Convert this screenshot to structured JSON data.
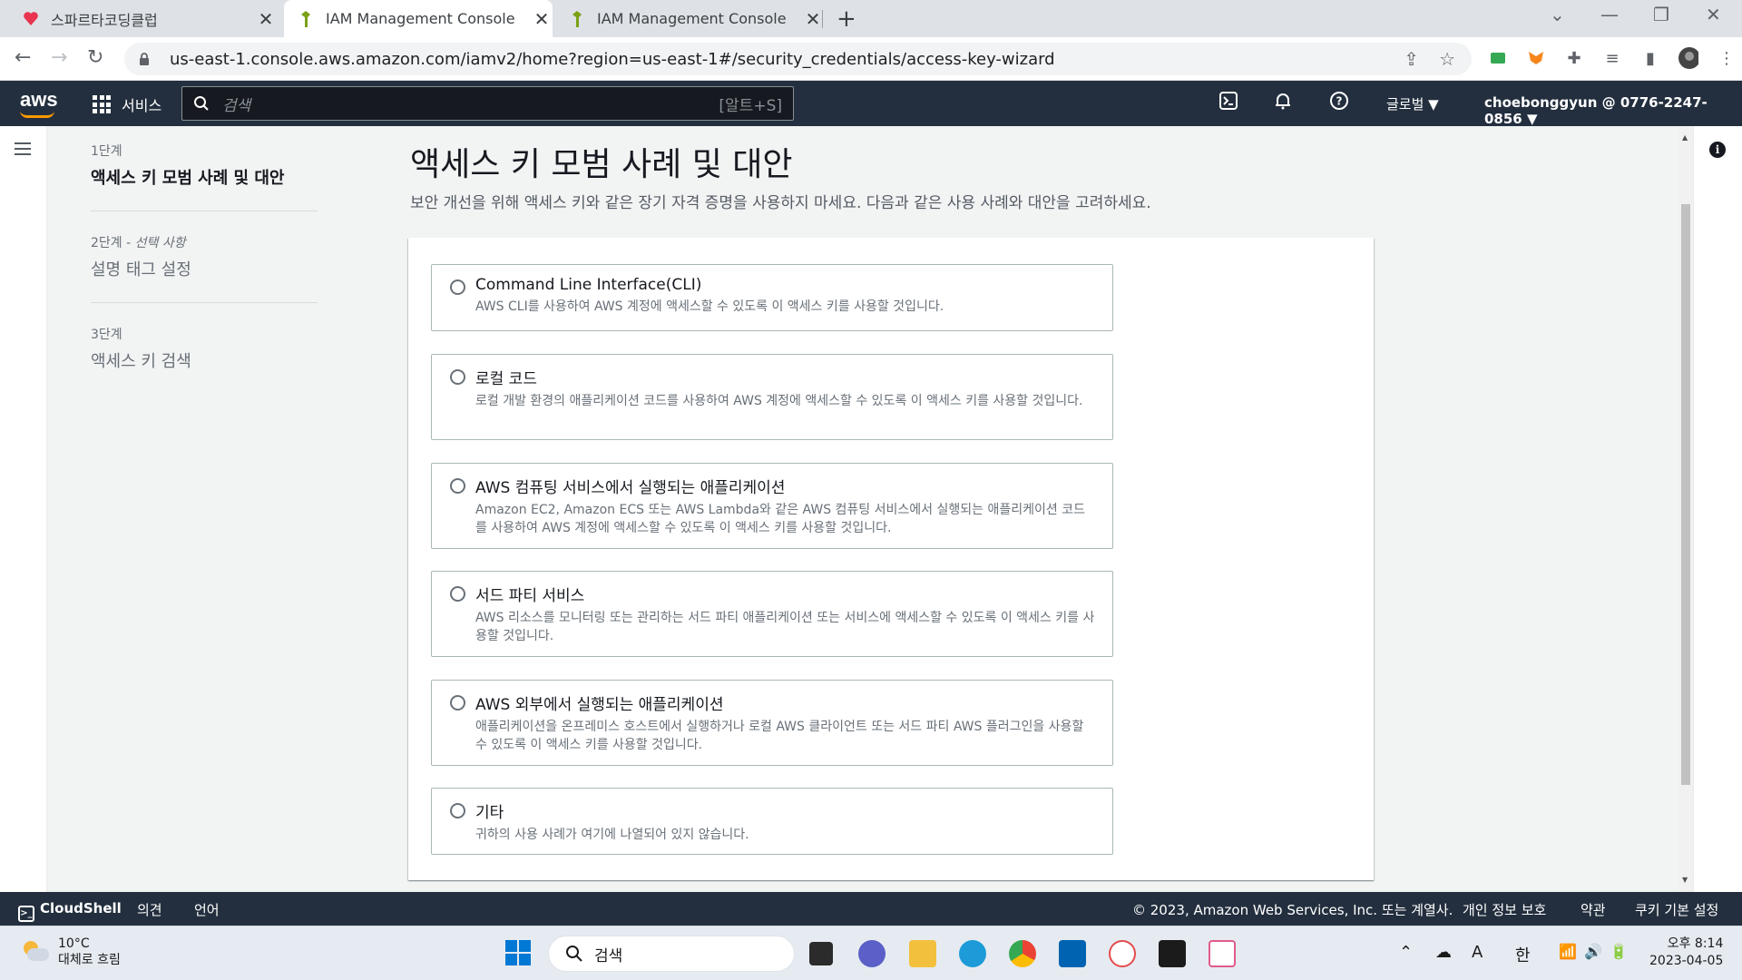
{
  "browser": {
    "tabs": [
      {
        "title": "스파르타코딩클럽"
      },
      {
        "title": "IAM Management Console"
      },
      {
        "title": "IAM Management Console"
      }
    ],
    "url": "us-east-1.console.aws.amazon.com/iamv2/home?region=us-east-1#/security_credentials/access-key-wizard"
  },
  "aws_nav": {
    "logo": "aws",
    "services_label": "서비스",
    "search_placeholder": "검색",
    "search_shortcut": "[알트+S]",
    "region": "글로벌 ▼",
    "account": "choebonggyun @ 0776-2247-0856 ▼"
  },
  "steps": [
    {
      "num": "1단계",
      "title": "액세스 키 모범 사례 및 대안"
    },
    {
      "num": "2단계 - ",
      "optional": "선택 사항",
      "title": "설명 태그 설정"
    },
    {
      "num": "3단계",
      "title": "액세스 키 검색"
    }
  ],
  "page": {
    "title": "액세스 키 모범 사례 및 대안",
    "description": "보안 개선을 위해 액세스 키와 같은 장기 자격 증명을 사용하지 마세요. 다음과 같은 사용 사례와 대안을 고려하세요."
  },
  "options": [
    {
      "title": "Command Line Interface(CLI)",
      "desc": "AWS CLI를 사용하여 AWS 계정에 액세스할 수 있도록 이 액세스 키를 사용할 것입니다."
    },
    {
      "title": "로컬 코드",
      "desc": "로컬 개발 환경의 애플리케이션 코드를 사용하여 AWS 계정에 액세스할 수 있도록 이 액세스 키를 사용할 것입니다."
    },
    {
      "title": "AWS 컴퓨팅 서비스에서 실행되는 애플리케이션",
      "desc": "Amazon EC2, Amazon ECS 또는 AWS Lambda와 같은 AWS 컴퓨팅 서비스에서 실행되는 애플리케이션 코드를 사용하여 AWS 계정에 액세스할 수 있도록 이 액세스 키를 사용할 것입니다."
    },
    {
      "title": "서드 파티 서비스",
      "desc": "AWS 리소스를 모니터링 또는 관리하는 서드 파티 애플리케이션 또는 서비스에 액세스할 수 있도록 이 액세스 키를 사용할 것입니다."
    },
    {
      "title": "AWS 외부에서 실행되는 애플리케이션",
      "desc": "애플리케이션을 온프레미스 호스트에서 실행하거나 로컬 AWS 클라이언트 또는 서드 파티 AWS 플러그인을 사용할 수 있도록 이 액세스 키를 사용할 것입니다."
    },
    {
      "title": "기타",
      "desc": "귀하의 사용 사례가 여기에 나열되어 있지 않습니다."
    }
  ],
  "footer": {
    "cloudshell": "CloudShell",
    "feedback": "의견",
    "language": "언어",
    "copyright": "© 2023, Amazon Web Services, Inc. 또는 계열사.",
    "privacy": "개인 정보 보호",
    "terms": "약관",
    "cookies": "쿠키 기본 설정"
  },
  "taskbar": {
    "weather_temp": "10°C",
    "weather_desc": "대체로 흐림",
    "search_label": "검색",
    "ime_a": "A",
    "ime_han": "한",
    "time": "오후 8:14",
    "date": "2023-04-05"
  },
  "colors": {
    "aws_nav_bg": "#232f3e",
    "aws_orange": "#ff9900"
  }
}
